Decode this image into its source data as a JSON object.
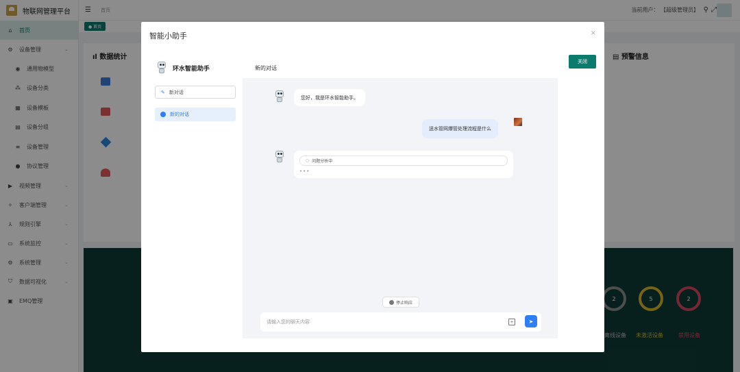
{
  "app": {
    "title": "物联网管理平台"
  },
  "topbar": {
    "breadcrumb": "首页",
    "current_user": "当前用户： 【超级管理员】"
  },
  "tagbar": {
    "tab": "● 首页"
  },
  "sidebar": {
    "items": [
      {
        "label": "首页",
        "icon": "home-icon",
        "active": true
      },
      {
        "label": "设备管理",
        "icon": "gear-icon",
        "chevron": "⌄"
      },
      {
        "label": "通用物模型",
        "icon": "disc-icon",
        "sub": true
      },
      {
        "label": "设备分类",
        "icon": "tree-icon",
        "sub": true
      },
      {
        "label": "设备模板",
        "icon": "grid-icon",
        "sub": true
      },
      {
        "label": "设备分组",
        "icon": "table-icon",
        "sub": true
      },
      {
        "label": "设备管理",
        "icon": "list-icon",
        "sub": true
      },
      {
        "label": "协议管理",
        "icon": "circle-icon",
        "sub": true
      },
      {
        "label": "视频管理",
        "icon": "video-icon",
        "chevron": "⌄"
      },
      {
        "label": "客户端管理",
        "icon": "client-icon",
        "chevron": "⌄"
      },
      {
        "label": "规则引擎",
        "icon": "rule-icon",
        "chevron": "⌄"
      },
      {
        "label": "系统监控",
        "icon": "monitor-icon",
        "chevron": "⌄"
      },
      {
        "label": "系统管理",
        "icon": "settings-icon",
        "chevron": "⌄"
      },
      {
        "label": "数据可视化",
        "icon": "shield-icon",
        "chevron": "⌄"
      },
      {
        "label": "EMQ管理",
        "icon": "server-icon"
      }
    ]
  },
  "dashboard": {
    "stats_title": "数据统计",
    "warn_title": "预警信息",
    "rings": [
      {
        "value": "2",
        "label": "",
        "color": "#8a8f8e"
      },
      {
        "value": "5",
        "label": "未激活设备",
        "color": "#d6b72a"
      },
      {
        "value": "2",
        "label": "禁用设备",
        "color": "#d9485f"
      }
    ],
    "offline_label": "离线设备"
  },
  "modal": {
    "title": "智能小助手",
    "close_glyph": "×",
    "close_button": "关闭",
    "assistant_name": "环水智能助手",
    "new_chat_button": "新对话",
    "conversation": "新的对话",
    "chat_title": "新的对话",
    "messages": {
      "greeting": "您好，我是环水智能助手。",
      "user": "送水管网爆管处理流程是什么",
      "analyzing": "问题分析中",
      "typing": "•••"
    },
    "stop_button": "停止响应",
    "input_placeholder": "请输入您的聊天内容",
    "send_glyph": "➤"
  }
}
